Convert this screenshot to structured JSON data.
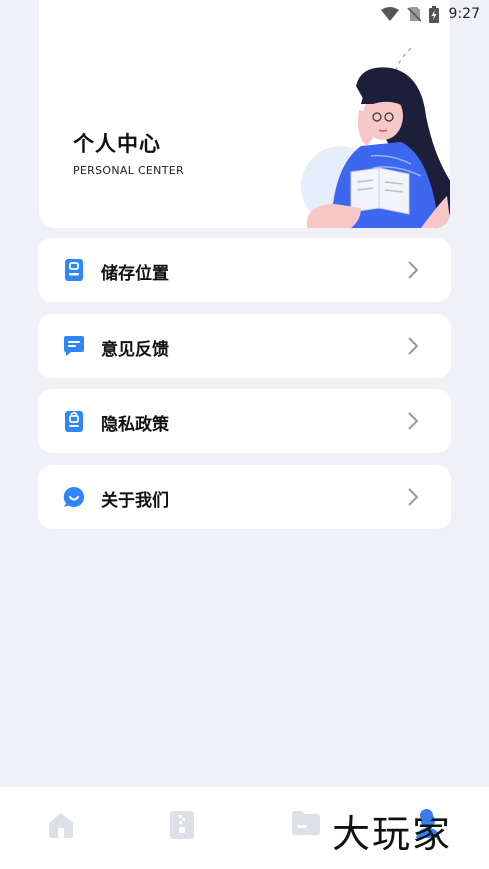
{
  "status_bar": {
    "time": "9:27"
  },
  "header": {
    "title": "个人中心",
    "subtitle": "PERSONAL CENTER"
  },
  "menu": {
    "items": [
      {
        "label": "储存位置",
        "icon": "storage-icon"
      },
      {
        "label": "意见反馈",
        "icon": "feedback-icon"
      },
      {
        "label": "隐私政策",
        "icon": "privacy-icon"
      },
      {
        "label": "关于我们",
        "icon": "about-icon"
      }
    ]
  },
  "tab_bar": {
    "tabs": [
      {
        "icon": "home-icon"
      },
      {
        "icon": "document-icon"
      },
      {
        "icon": "folder-icon"
      },
      {
        "icon": "profile-icon"
      }
    ]
  },
  "watermark": {
    "text": "大玩家"
  },
  "colors": {
    "accent": "#2f86f6",
    "background": "#eff1f6",
    "card": "#ffffff"
  }
}
